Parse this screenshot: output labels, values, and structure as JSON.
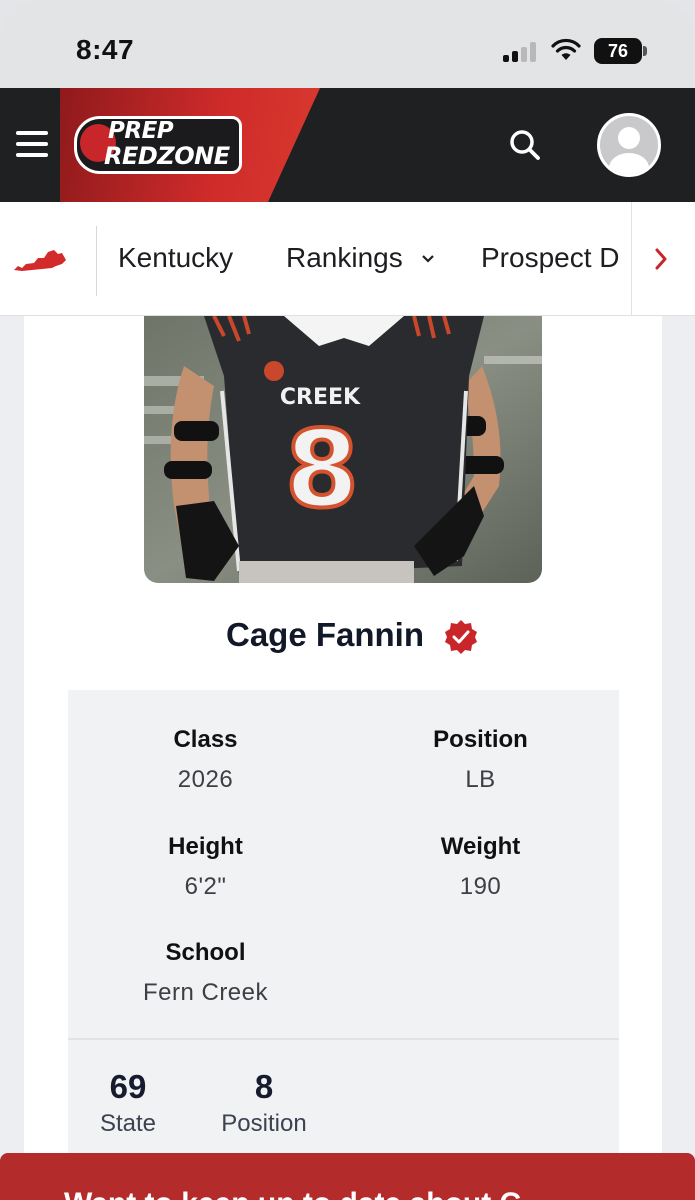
{
  "status_bar": {
    "time": "8:47",
    "battery": "76",
    "signal_icon": "cellular-signal-icon",
    "wifi_icon": "wifi-icon"
  },
  "header": {
    "logo_line1": "PREP",
    "logo_line2": "REDZONE",
    "menu_icon": "hamburger-menu-icon",
    "search_icon": "search-icon",
    "avatar_icon": "user-avatar-icon"
  },
  "nav": {
    "state_icon": "kentucky-state-icon",
    "items": [
      {
        "label": "Kentucky"
      },
      {
        "label": "Rankings"
      },
      {
        "label": "Prospect D"
      }
    ],
    "next_icon": "chevron-right-icon"
  },
  "player": {
    "jersey_team": "CREEK",
    "jersey_number": "8",
    "name": "Cage Fannin",
    "verified_icon": "verified-badge-icon",
    "details": {
      "class_label": "Class",
      "class_value": "2026",
      "position_label": "Position",
      "position_value": "LB",
      "height_label": "Height",
      "height_value": "6'2\"",
      "weight_label": "Weight",
      "weight_value": "190",
      "school_label": "School",
      "school_value": "Fern Creek"
    },
    "rankings": [
      {
        "value": "69",
        "label": "State"
      },
      {
        "value": "8",
        "label": "Position"
      }
    ]
  },
  "banner": {
    "text": "Want to keep up to date about C..."
  },
  "colors": {
    "brand_red": "#c8262a",
    "header_dark": "#1f2022",
    "banner_red": "#b42b2b"
  }
}
